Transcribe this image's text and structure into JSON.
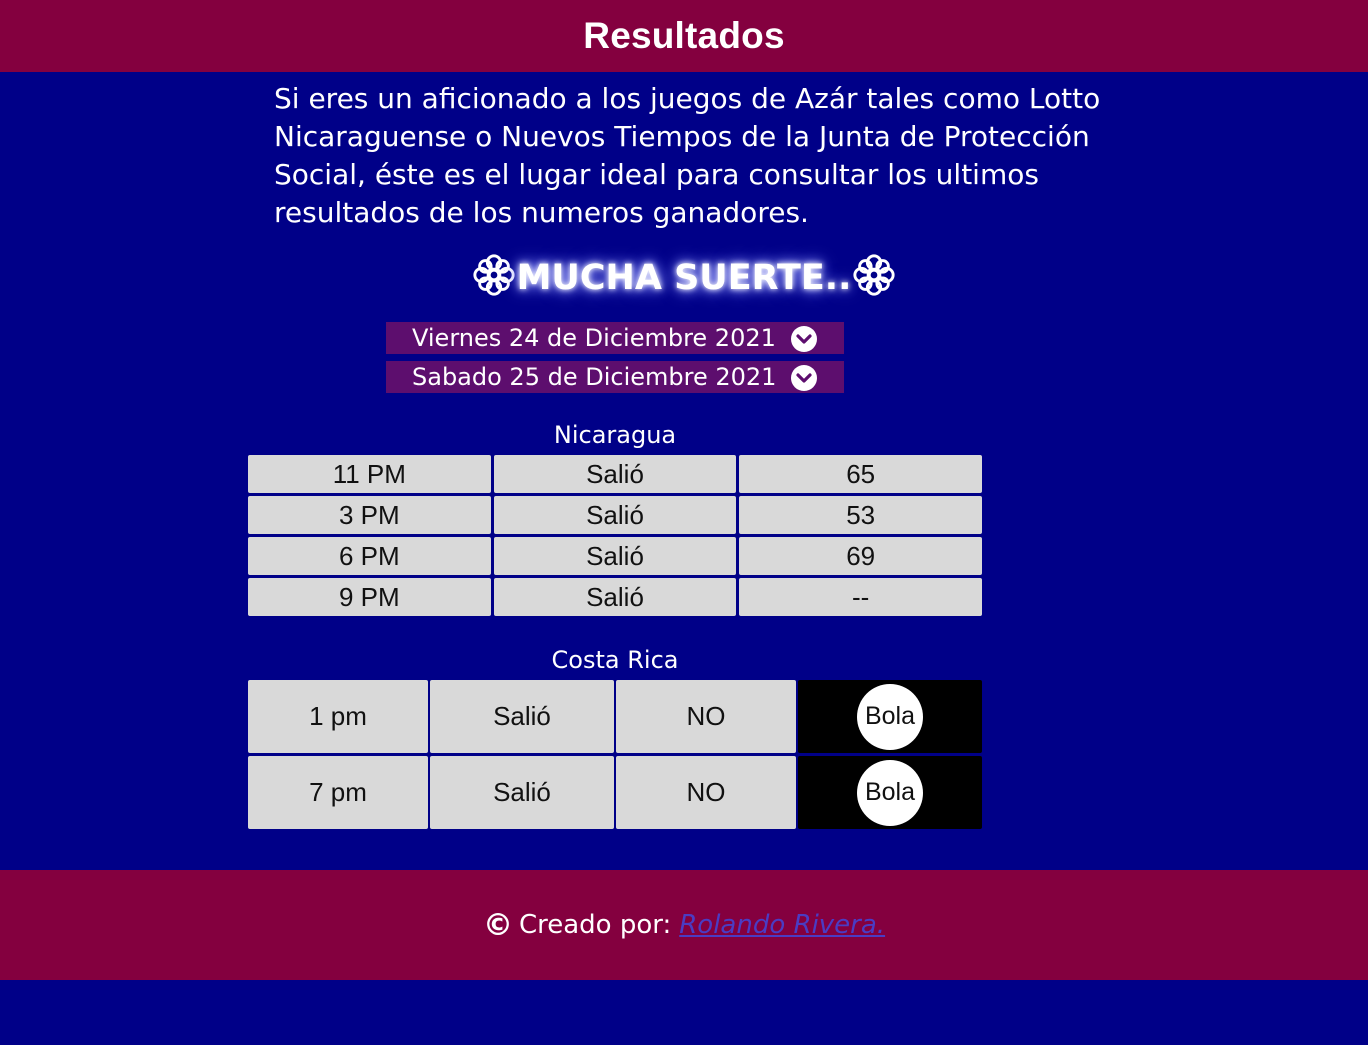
{
  "header": {
    "title": "Resultados"
  },
  "intro": {
    "text": "Si eres un aficionado a los juegos de Azár tales como Lotto Nicaraguense o Nuevos Tiempos de la Junta de Protección Social, éste es el lugar ideal para consultar los ultimos resultados de los numeros ganadores."
  },
  "luck": {
    "text": "MUCHA SUERTE..",
    "icon": "flower-icon"
  },
  "dates": [
    {
      "label": "Viernes 24 de Diciembre 2021",
      "icon": "chevron-down-icon"
    },
    {
      "label": "Sabado 25 de Diciembre 2021",
      "icon": "chevron-down-icon"
    }
  ],
  "nicaragua": {
    "title": "Nicaragua",
    "rows": [
      {
        "time": "11 PM",
        "status": "Salió",
        "number": "65"
      },
      {
        "time": "3 PM",
        "status": "Salió",
        "number": "53"
      },
      {
        "time": "6 PM",
        "status": "Salió",
        "number": "69"
      },
      {
        "time": "9 PM",
        "status": "Salió",
        "number": "--"
      }
    ]
  },
  "costa_rica": {
    "title": "Costa Rica",
    "rows": [
      {
        "time": "1 pm",
        "status": "Salió",
        "result": "NO",
        "ball": "Bola"
      },
      {
        "time": "7 pm",
        "status": "Salió",
        "result": "NO",
        "ball": "Bola"
      }
    ]
  },
  "footer": {
    "copyright_symbol": "©",
    "created_by": "Creado por:",
    "author": "Rolando Rivera."
  },
  "colors": {
    "background": "#000088",
    "bar": "#84003f",
    "date_bar": "#5d0e6e",
    "cell": "#d9d9d9",
    "link": "#4a3cc4"
  }
}
